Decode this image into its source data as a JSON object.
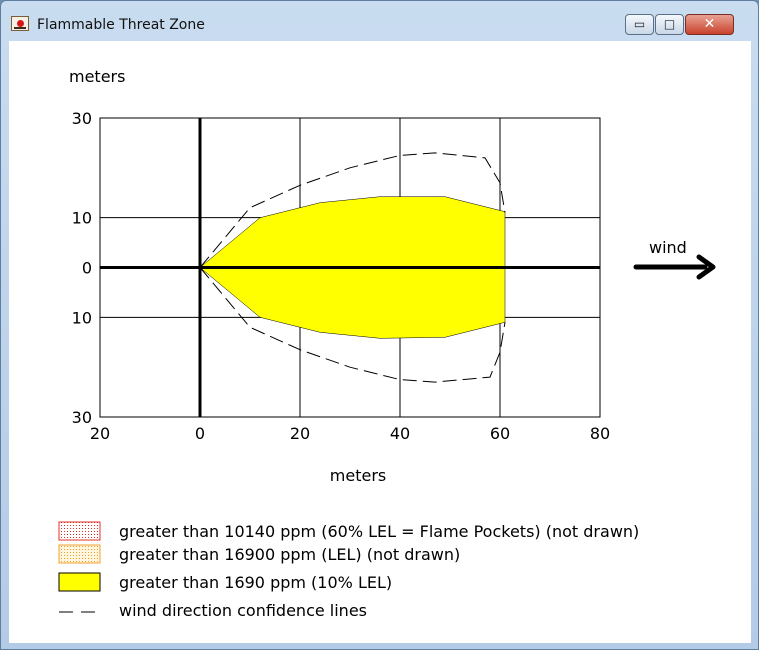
{
  "window": {
    "title": "Flammable Threat Zone",
    "controls": {
      "minimize": "▭",
      "maximize": "□",
      "close": "✕"
    }
  },
  "chart_data": {
    "type": "area",
    "xlabel": "meters",
    "ylabel": "meters",
    "xlim": [
      -20,
      80
    ],
    "ylim": [
      -30,
      30
    ],
    "x_ticks": [
      -20,
      0,
      20,
      40,
      60,
      80
    ],
    "x_tick_labels": [
      "20",
      "0",
      "20",
      "40",
      "60",
      "80"
    ],
    "y_ticks": [
      30,
      10,
      0,
      -10,
      -30
    ],
    "y_tick_labels": [
      "30",
      "10",
      "0",
      "10",
      "30"
    ],
    "grid": true,
    "wind_label": "wind",
    "series": [
      {
        "name": "greater than 1690 ppm (10% LEL)",
        "color": "#ffff00",
        "points": [
          [
            0,
            0
          ],
          [
            12,
            10
          ],
          [
            24,
            13
          ],
          [
            36,
            14.2
          ],
          [
            49,
            14.2
          ],
          [
            61,
            11.2
          ],
          [
            61,
            -11
          ],
          [
            49,
            -14
          ],
          [
            36,
            -14.2
          ],
          [
            24,
            -13
          ],
          [
            12,
            -10
          ],
          [
            0,
            0
          ]
        ]
      },
      {
        "name": "wind direction confidence lines",
        "style": "dashed",
        "points": [
          [
            0,
            0
          ],
          [
            10,
            12
          ],
          [
            20,
            16.5
          ],
          [
            30,
            20
          ],
          [
            40,
            22.5
          ],
          [
            47,
            23
          ],
          [
            57,
            22
          ],
          [
            60,
            17
          ],
          [
            61,
            11
          ]
        ]
      },
      {
        "name": "wind direction confidence lines",
        "style": "dashed",
        "points": [
          [
            0,
            0
          ],
          [
            10,
            -12
          ],
          [
            20,
            -16.5
          ],
          [
            30,
            -20
          ],
          [
            40,
            -22.5
          ],
          [
            47,
            -23
          ],
          [
            58,
            -22
          ],
          [
            60,
            -17
          ],
          [
            61,
            -11
          ]
        ]
      }
    ],
    "legend": [
      {
        "label": "greater than 10140 ppm (60% LEL = Flame Pockets) (not drawn)",
        "swatch": "dotted",
        "color": "#e0302a"
      },
      {
        "label": "greater than 16900 ppm (LEL) (not drawn)",
        "swatch": "dotted",
        "color": "#f0a030"
      },
      {
        "label": "greater than 1690 ppm (10% LEL)",
        "swatch": "solid",
        "color": "#ffff00"
      },
      {
        "label": "wind direction confidence lines",
        "swatch": "dash",
        "color": "#000000"
      }
    ]
  }
}
